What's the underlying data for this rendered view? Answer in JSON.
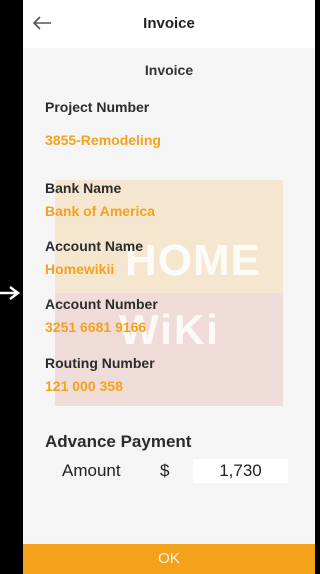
{
  "header": {
    "title": "Invoice",
    "back_icon": "arrow-left-icon"
  },
  "subtitle": "Invoice",
  "project": {
    "label": "Project Number",
    "value": "3855-Remodeling"
  },
  "bank": {
    "label": "Bank Name",
    "value": "Bank of America"
  },
  "account_name": {
    "label": "Account Name",
    "value": "Homewikii"
  },
  "account_number": {
    "label": "Account Number",
    "value": "3251 6681 9166"
  },
  "routing": {
    "label": "Routing Number",
    "value": "121 000 358"
  },
  "watermark": {
    "line1": "HOME",
    "line2": "WiKi"
  },
  "advance": {
    "title": "Advance Payment",
    "amount_label": "Amount",
    "currency": "$",
    "amount_value": "1,730"
  },
  "ok_label": "OK",
  "colors": {
    "accent": "#f4a21c",
    "background": "#f5f5f5",
    "header": "#ffffff"
  }
}
